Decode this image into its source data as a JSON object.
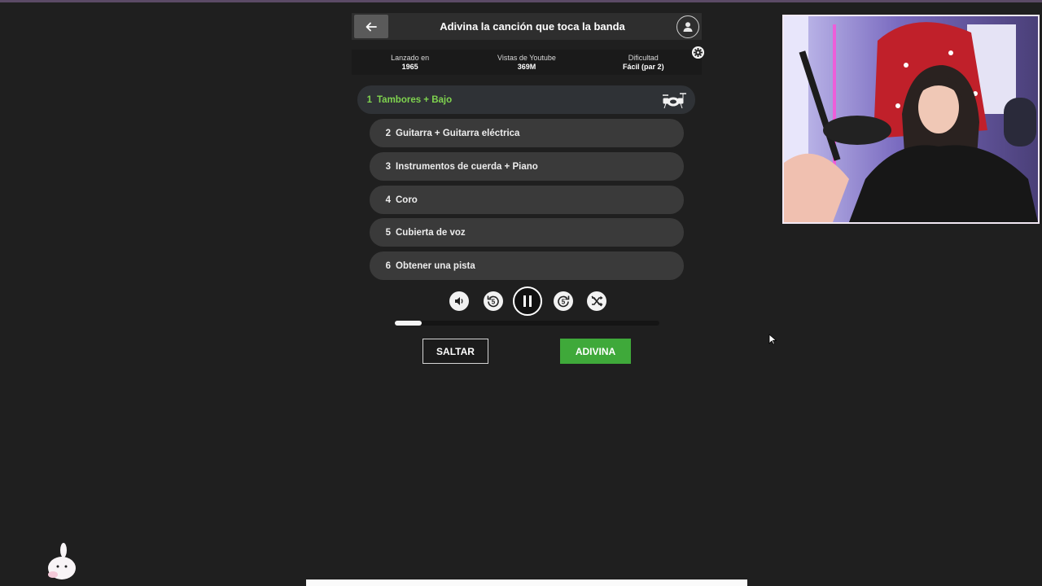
{
  "header": {
    "title": "Adivina la canción que toca la banda"
  },
  "stats": [
    {
      "label": "Lanzado en",
      "value": "1965"
    },
    {
      "label": "Vistas de Youtube",
      "value": "369M"
    },
    {
      "label": "Dificultad",
      "value": "Fácil (par 2)"
    }
  ],
  "hints": [
    {
      "num": "1",
      "label": "Tambores + Bajo",
      "active": true
    },
    {
      "num": "2",
      "label": "Guitarra + Guitarra eléctrica"
    },
    {
      "num": "3",
      "label": "Instrumentos de cuerda + Piano"
    },
    {
      "num": "4",
      "label": "Coro"
    },
    {
      "num": "5",
      "label": "Cubierta de voz"
    },
    {
      "num": "6",
      "label": "Obtener una pista"
    }
  ],
  "player": {
    "controls": [
      "volume-icon",
      "rewind-5-icon",
      "pause-icon",
      "forward-5-icon",
      "shuffle-off-icon"
    ],
    "rewind_seconds": "5",
    "forward_seconds": "5",
    "progress": 0.1
  },
  "actions": {
    "skip_label": "SALTAR",
    "guess_label": "ADIVINA"
  },
  "colors": {
    "accent_green": "#3fa93a",
    "active_hint_text": "#7fd34f",
    "background": "#1f1f1f"
  }
}
